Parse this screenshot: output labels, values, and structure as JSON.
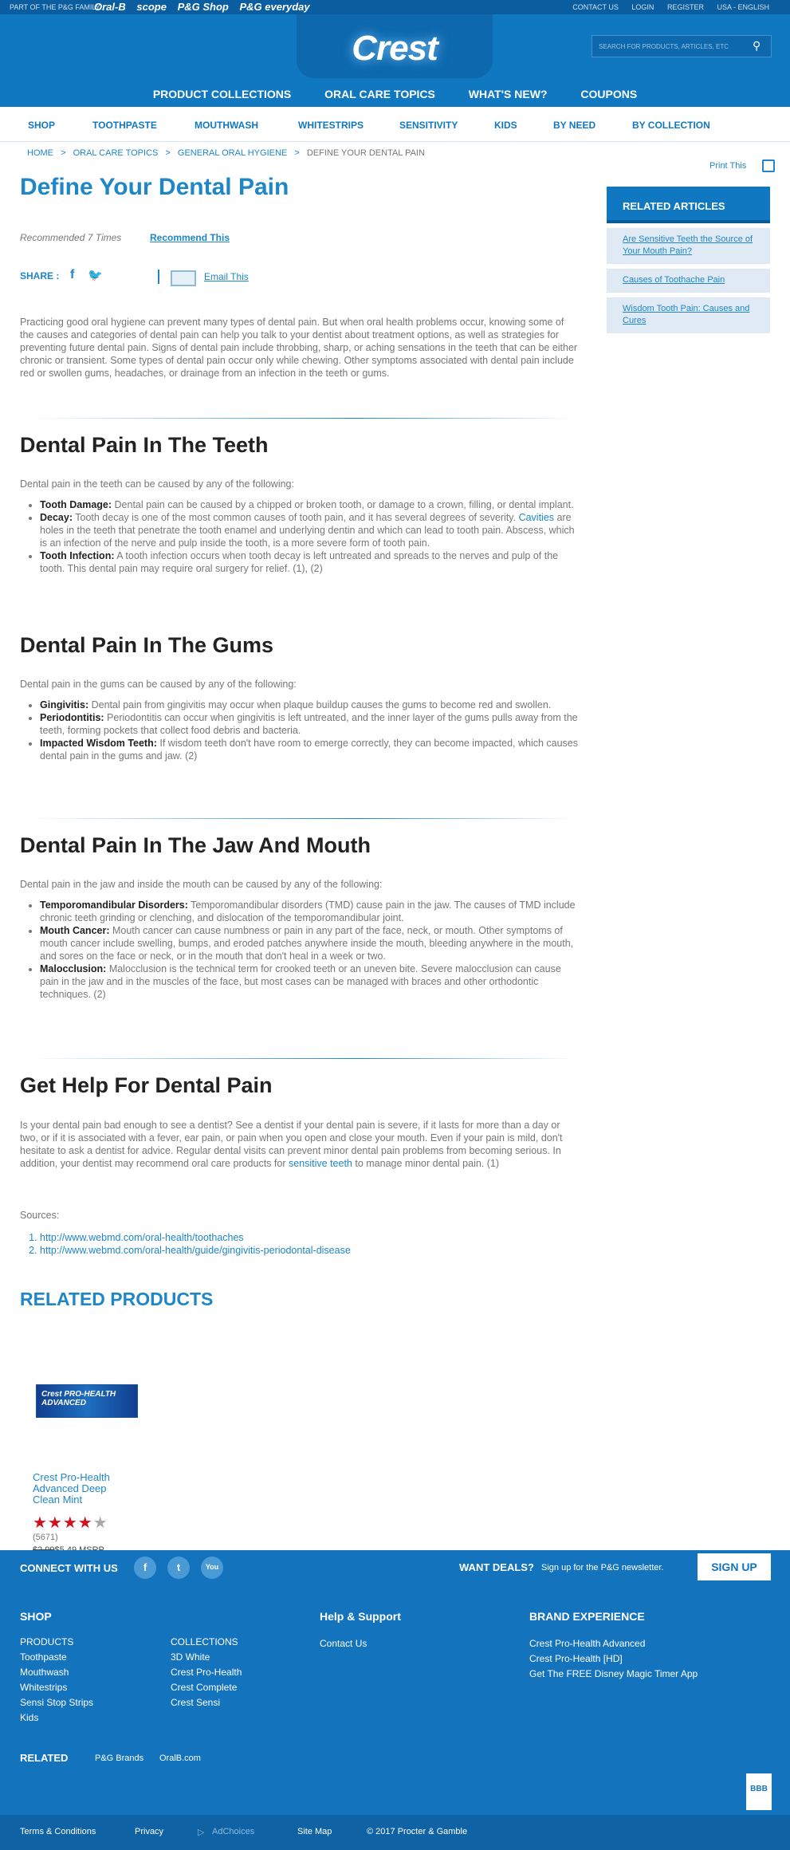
{
  "topbar": {
    "family": "PART OF THE P&G FAMILY:",
    "brands": [
      "Oral-B",
      "scope",
      "P&G Shop",
      "P&G everyday"
    ],
    "links": [
      "CONTACT US",
      "LOGIN",
      "REGISTER",
      "USA - ENGLISH"
    ]
  },
  "header": {
    "logo": "Crest",
    "search_placeholder": "SEARCH FOR PRODUCTS, ARTICLES, ETC",
    "nav": [
      "PRODUCT COLLECTIONS",
      "ORAL CARE TOPICS",
      "WHAT'S NEW?",
      "COUPONS"
    ]
  },
  "subnav": [
    "SHOP",
    "TOOTHPASTE",
    "MOUTHWASH",
    "WHITESTRIPS",
    "SENSITIVITY",
    "KIDS",
    "BY NEED",
    "BY COLLECTION"
  ],
  "breadcrumb": [
    "HOME",
    ">",
    "ORAL CARE TOPICS",
    ">",
    "GENERAL ORAL HYGIENE",
    ">",
    "DEFINE YOUR DENTAL PAIN"
  ],
  "print_label": "Print This",
  "article": {
    "title": "Define Your Dental Pain",
    "recommended": "Recommended 7 Times",
    "recommend_link": "Recommend This",
    "share_label": "SHARE :",
    "email_label": "Email This",
    "intro": "Practicing good oral hygiene can prevent many types of dental pain. But when oral health problems occur, knowing some of the causes and categories of dental pain can help you talk to your dentist about treatment options, as well as strategies for preventing future dental pain. Signs of dental pain include throbbing, sharp, or aching sensations in the teeth that can be either chronic or transient. Some types of dental pain occur only while chewing. Other symptoms associated with dental pain include red or swollen gums, headaches, or drainage from an infection in the teeth or gums.",
    "teeth": {
      "heading": "Dental Pain In The Teeth",
      "lead": "Dental pain in the teeth can be caused by any of the following:",
      "items": [
        {
          "term": "Tooth Damage:",
          "text": " Dental pain can be caused by a chipped or broken tooth, or damage to a crown, filling, or dental implant."
        },
        {
          "term": "Decay:",
          "text_a": " Tooth decay is one of the most common causes of tooth pain, and it has several degrees of severity. ",
          "link": "Cavities",
          "text_b": " are holes in the teeth that penetrate the tooth enamel and underlying dentin and which can lead to tooth pain. Abscess, which is an infection of the nerve and pulp inside the tooth, is a more severe form of tooth pain."
        },
        {
          "term": "Tooth Infection:",
          "text": " A tooth infection occurs when tooth decay is left untreated and spreads to the nerves and pulp of the tooth. This dental pain may require oral surgery for relief. (1), (2)"
        }
      ]
    },
    "gums": {
      "heading": "Dental Pain In The Gums",
      "lead": "Dental pain in the gums can be caused by any of the following:",
      "items": [
        {
          "term": "Gingivitis:",
          "text": " Dental pain from gingivitis may occur when plaque buildup causes the gums to become red and swollen."
        },
        {
          "term": "Periodontitis:",
          "text": " Periodontitis can occur when gingivitis is left untreated, and the inner layer of the gums pulls away from the teeth, forming pockets that collect food debris and bacteria."
        },
        {
          "term": "Impacted Wisdom Teeth:",
          "text": " If wisdom teeth don't have room to emerge correctly, they can become impacted, which causes dental pain in the gums and jaw. (2)"
        }
      ]
    },
    "jaw": {
      "heading": "Dental Pain In The Jaw And Mouth",
      "lead": "Dental pain in the jaw and inside the mouth can be caused by any of the following:",
      "items": [
        {
          "term": "Temporomandibular Disorders:",
          "text": " Temporomandibular disorders (TMD) cause pain in the jaw. The causes of TMD include chronic teeth grinding or clenching, and dislocation of the temporomandibular joint."
        },
        {
          "term": "Mouth Cancer:",
          "text": " Mouth cancer can cause numbness or pain in any part of the face, neck, or mouth. Other symptoms of mouth cancer include swelling, bumps, and eroded patches anywhere inside the mouth, bleeding anywhere in the mouth, and sores on the face or neck, or in the mouth that don't heal in a week or two."
        },
        {
          "term": "Malocclusion:",
          "text": " Malocclusion is the technical term for crooked teeth or an uneven bite. Severe malocclusion can cause pain in the jaw and in the muscles of the face, but most cases can be managed with braces and other orthodontic techniques. (2)"
        }
      ]
    },
    "help": {
      "heading": "Get Help For Dental Pain",
      "text_a": "Is your dental pain bad enough to see a dentist? See a dentist if your dental pain is severe, if it lasts for more than a day or two, or if it is associated with a fever, ear pain, or pain when you open and close your mouth. Even if your pain is mild, don't hesitate to ask a dentist for advice. Regular dental visits can prevent minor dental pain problems from becoming serious. In addition, your dentist may recommend oral care products for ",
      "link": "sensitive teeth",
      "text_b": " to manage minor dental pain. (1)"
    },
    "sources_label": "Sources:",
    "sources": [
      "http://www.webmd.com/oral-health/toothaches",
      "http://www.webmd.com/oral-health/guide/gingivitis-periodontal-disease"
    ]
  },
  "related_articles": {
    "heading": "RELATED ARTICLES",
    "items": [
      "Are Sensitive Teeth the Source of Your Mouth Pain?",
      "Causes of Toothache Pain",
      "Wisdom Tooth Pain: Causes and Cures"
    ]
  },
  "related_products": {
    "heading": "RELATED PRODUCTS",
    "product": {
      "box_text": "Crest PRO-HEALTH ADVANCED",
      "name": "Crest Pro-Health Advanced Deep Clean Mint",
      "rating": 4,
      "rating_max": 5,
      "reviews": "(5671)",
      "price_old": "$2.99",
      "price": "$5.49 MSRP"
    }
  },
  "footer": {
    "connect": "CONNECT WITH US",
    "social": [
      "f",
      "t",
      "You"
    ],
    "deals_title": "WANT DEALS?",
    "deals_text": "Sign up for the P&G newsletter.",
    "signup": "SIGN UP",
    "shop_heading": "SHOP",
    "shop_col1": [
      "PRODUCTS",
      "Toothpaste",
      "Mouthwash",
      "Whitestrips",
      "Sensi Stop Strips",
      "Kids"
    ],
    "shop_col2": [
      "COLLECTIONS",
      "3D White",
      "Crest Pro-Health",
      "Crest Complete",
      "Crest Sensi"
    ],
    "help_heading": "Help & Support",
    "help_links": [
      "Contact Us"
    ],
    "brand_heading": "BRAND EXPERIENCE",
    "brand_links": [
      "Crest Pro-Health Advanced",
      "Crest Pro-Health [HD]",
      "Get The FREE Disney Magic Timer App"
    ],
    "related_label": "RELATED",
    "related_links": [
      "P&G Brands",
      "OralB.com"
    ],
    "bbb": "BBB",
    "bottom": [
      "Terms & Conditions",
      "Privacy",
      "AdChoices",
      "Site Map",
      "© 2017 Procter & Gamble"
    ]
  }
}
